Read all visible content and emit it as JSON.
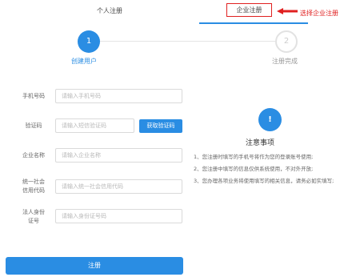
{
  "tabs": {
    "personal": "个人注册",
    "enterprise": "企业注册"
  },
  "annotation": "选择企业注册",
  "steps": [
    {
      "number": "1",
      "label": "创建用户"
    },
    {
      "number": "2",
      "label": "注册完成"
    }
  ],
  "form": {
    "phone": {
      "label": "手机号码",
      "placeholder": "请输入手机号码",
      "value": ""
    },
    "code": {
      "label": "验证码",
      "placeholder": "请输入短信验证码",
      "value": "",
      "button": "获取验证码"
    },
    "company_name": {
      "label": "企业名称",
      "placeholder": "请输入企业名称",
      "value": ""
    },
    "credit_code": {
      "label_line1": "统一社会",
      "label_line2": "信用代码",
      "placeholder": "请输入统一社会信用代码",
      "value": ""
    },
    "legal_id": {
      "label_line1": "法人身份",
      "label_line2": "证号",
      "placeholder": "请输入身份证号码",
      "value": ""
    }
  },
  "notice": {
    "icon_symbol": "!",
    "title": "注意事项",
    "items": [
      "1、您注册时填写的手机号将作为您的登录账号使用;",
      "2、您注册中填写的信息仅供系统使用，不对外开放;",
      "3、您办理各项业务将使用填写的相关信息，请务必如实填写;"
    ]
  },
  "submit_label": "注册",
  "colors": {
    "accent": "#2a8de3",
    "annotation": "#e02020"
  },
  "icons": {
    "annotation_arrow": "left-arrow-icon",
    "notice": "exclamation-icon"
  }
}
